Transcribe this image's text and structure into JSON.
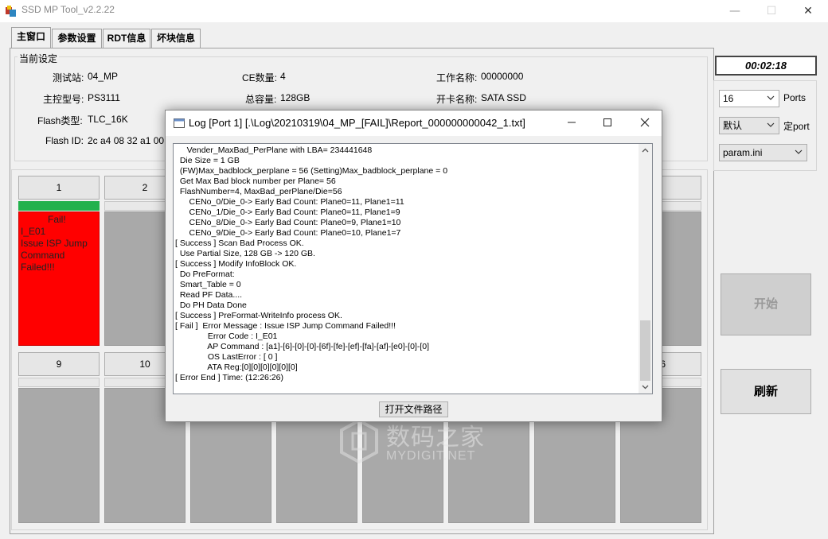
{
  "window": {
    "title": "SSD MP Tool_v2.2.22",
    "app_icon": "app-icon",
    "minimize": "—",
    "maximize": "☐",
    "close": "✕"
  },
  "tabs": [
    {
      "label": "主窗口"
    },
    {
      "label": "参数设置"
    },
    {
      "label": "RDT信息"
    },
    {
      "label": "坏块信息"
    }
  ],
  "settings": {
    "legend": "当前设定",
    "station_label": "测试站:",
    "station_value": "04_MP",
    "ce_label": "CE数量:",
    "ce_value": "4",
    "work_label": "工作名称:",
    "work_value": "00000000",
    "controller_label": "主控型号:",
    "controller_value": "PS3111",
    "capacity_label": "总容量:",
    "capacity_value": "128GB",
    "card_label": "开卡名称:",
    "card_value": "SATA SSD",
    "flash_type_label": "Flash类型:",
    "flash_type_value": "TLC_16K",
    "flash_id_label": "Flash ID:",
    "flash_id_value": "2c a4 08 32 a1 00"
  },
  "slots_row1": [
    "1",
    "2",
    "",
    "",
    "",
    "",
    "",
    ""
  ],
  "slots_row2": [
    "9",
    "10",
    "",
    "",
    "",
    "",
    "",
    "6"
  ],
  "slot1_status": {
    "line1": "Fail!",
    "line2": "I_E01",
    "line3": "Issue ISP Jump",
    "line4": "Command",
    "line5": "Failed!!!"
  },
  "right_panel": {
    "timer": "00:02:18",
    "ports_value": "16",
    "ports_label": "Ports",
    "default_value": "默认",
    "fixed_port_label": "定port",
    "param_value": "param.ini",
    "start_button": "开始",
    "refresh_button": "刷新"
  },
  "log_dialog": {
    "title": "Log [Port 1] [.\\Log\\20210319\\04_MP_[FAIL]\\Report_000000000042_1.txt]",
    "lines": [
      "     Vender_MaxBad_PerPlane with LBA= 234441648",
      "  Die Size = 1 GB",
      "  (FW)Max_badblock_perplane = 56 (Setting)Max_badblock_perplane = 0",
      "  Get Max Bad block number per Plane= 56",
      "  FlashNumber=4, MaxBad_perPlane/Die=56",
      "      CENo_0/Die_0-> Early Bad Count: Plane0=11, Plane1=11",
      "      CENo_1/Die_0-> Early Bad Count: Plane0=11, Plane1=9",
      "      CENo_8/Die_0-> Early Bad Count: Plane0=9, Plane1=10",
      "      CENo_9/Die_0-> Early Bad Count: Plane0=10, Plane1=7",
      "[ Success ] Scan Bad Process OK.",
      "  Use Partial Size, 128 GB -> 120 GB.",
      "[ Success ] Modify InfoBlock OK.",
      "  Do PreFormat:",
      "  Smart_Table = 0",
      "  Read PF Data....",
      "  Do PH Data Done",
      "[ Success ] PreFormat-WriteInfo process OK.",
      "[ Fail ]  Error Message : Issue ISP Jump Command Failed!!!",
      "              Error Code : I_E01",
      "              AP Command : [a1]-[6]-[0]-[0]-[6f]-[fe]-[ef]-[fa]-[af]-[e0]-[0]-[0]",
      "              OS LastError : [ 0 ]",
      "              ATA Reg:[0][0][0][0][0][0]",
      "[ Error End ] Time: (12:26:26)"
    ],
    "open_path_button": "打开文件路径"
  },
  "watermark": {
    "cn": "数码之家",
    "en": "MYDIGIT.NET"
  }
}
